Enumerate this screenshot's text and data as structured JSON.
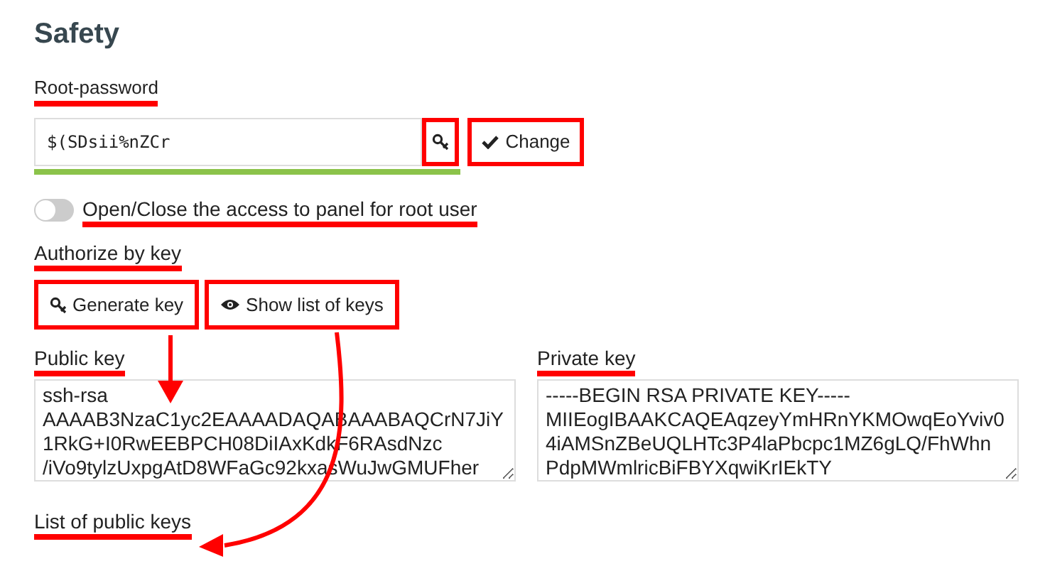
{
  "title": "Safety",
  "root_password": {
    "label": "Root-password",
    "label_highlighted": true,
    "value": "$(SDsii%nZCr",
    "generate_highlighted": true,
    "change_button": {
      "label": "Change",
      "highlighted": true
    },
    "strength": {
      "level": 1.0
    }
  },
  "root_access": {
    "label": "Open/Close the access to panel for root user",
    "on": false,
    "highlighted": true
  },
  "authorize": {
    "label": "Authorize by key",
    "highlighted": true
  },
  "buttons": [
    {
      "kind": "generate",
      "label": "Generate key",
      "highlighted": true
    },
    {
      "kind": "show",
      "label": "Show list of keys",
      "highlighted": true
    }
  ],
  "keys": [
    {
      "label": "Public key",
      "highlighted": true,
      "value": "ssh-rsa\nAAAAB3NzaC1yc2EAAAADAQABAAABAQCrN7JiY\n1RkG+I0RwEEBPCH08DiIAxKdkF6RAsdNzc\n/iVo9tylzUxpgAtD8WFaGc92kxasWuJwGMUFher"
    },
    {
      "label": "Private key",
      "highlighted": true,
      "value": "-----BEGIN RSA PRIVATE KEY-----\nMIIEogIBAAKCAQEAqzeyYmHRnYKMOwqEoYviv0\n4iAMSnZBeUQLHTc3P4laPbcpc1MZ6gLQ/FhWhn\nPdpMWmlricBiFBYXqwiKrIEkTY"
    }
  ],
  "list_label": {
    "label": "List of public keys",
    "highlighted": true
  }
}
